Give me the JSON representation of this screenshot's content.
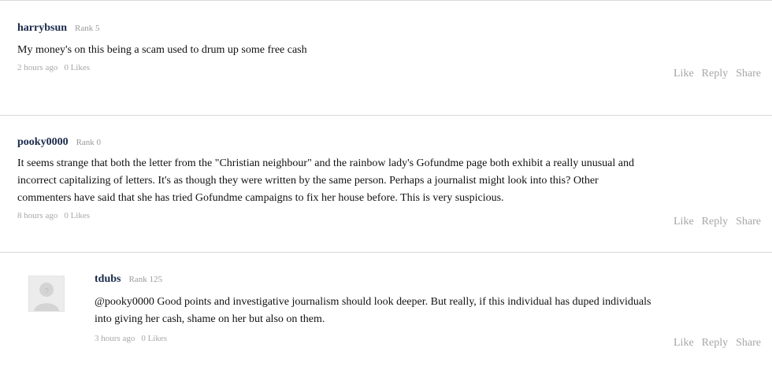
{
  "comments": [
    {
      "author": "harrybsun",
      "rank": "Rank 5",
      "text": "My money's on this being a scam used to drum up some free cash",
      "time": "2 hours ago",
      "likes": "0 Likes"
    },
    {
      "author": "pooky0000",
      "rank": "Rank 0",
      "lines": [
        "It seems strange that both the letter from the \"Christian neighbour\" and the rainbow lady's Gofundme page both exhibit a really unusual and",
        "incorrect capitalizing of letters. It's as though they were written by the same person. Perhaps a journalist might look into this? Other",
        "commenters have said that she has tried Gofundme campaigns to fix her house before. This is very suspicious."
      ],
      "time": "8 hours ago",
      "likes": "0 Likes"
    },
    {
      "author": "tdubs",
      "rank": "Rank 125",
      "lines": [
        "@pooky0000 Good points and investigative journalism should look deeper. But really, if this individual has duped individuals",
        "into giving her cash, shame on her but also on them."
      ],
      "time": "3 hours ago",
      "likes": "0 Likes",
      "avatar_icon": "default-user-avatar-icon"
    }
  ],
  "actions": {
    "like": "Like",
    "reply": "Reply",
    "share": "Share"
  }
}
